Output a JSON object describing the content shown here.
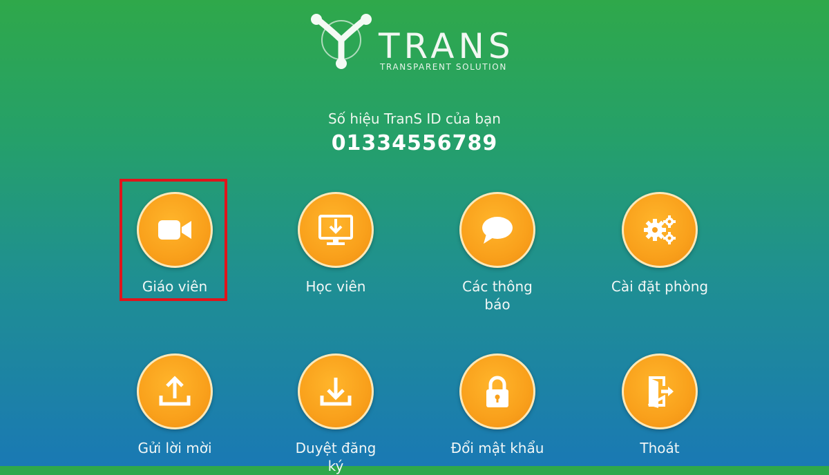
{
  "brand": {
    "name": "TRANS",
    "tagline": "TRANSPARENT SOLUTION",
    "colors": {
      "icon_fill": "#f9a01b",
      "icon_border": "#fde8b8",
      "highlight": "#e0141b"
    }
  },
  "id_section": {
    "label": "Số hiệu TranS ID của bạn",
    "value": "01334556789"
  },
  "menu": [
    {
      "label": "Giáo viên",
      "icon": "video-camera-icon",
      "highlighted": true
    },
    {
      "label": "Học viên",
      "icon": "monitor-download-icon"
    },
    {
      "label": "Các thông báo",
      "icon": "speech-bubble-icon"
    },
    {
      "label": "Cài đặt phòng",
      "icon": "gears-icon"
    },
    {
      "label": "Gửi lời mời",
      "icon": "upload-icon"
    },
    {
      "label": "Duyệt đăng ký",
      "icon": "download-icon"
    },
    {
      "label": "Đổi mật khẩu",
      "icon": "lock-icon"
    },
    {
      "label": "Thoát",
      "icon": "exit-door-icon"
    }
  ]
}
